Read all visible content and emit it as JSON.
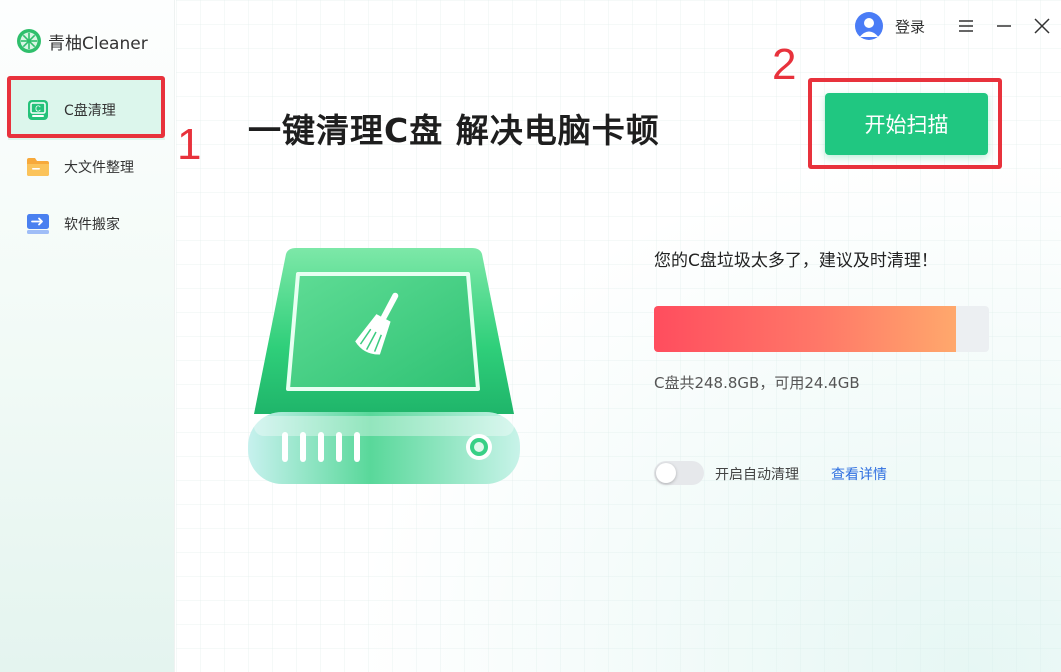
{
  "app": {
    "logo_text": "青柚Cleaner"
  },
  "sidebar": {
    "items": [
      {
        "label": "C盘清理",
        "icon": "disk-clean-icon",
        "active": true
      },
      {
        "label": "大文件整理",
        "icon": "folder-icon",
        "active": false
      },
      {
        "label": "软件搬家",
        "icon": "move-app-icon",
        "active": false
      }
    ]
  },
  "header": {
    "login_label": "登录"
  },
  "main": {
    "headline": "一键清理C盘 解决电脑卡顿",
    "scan_button": "开始扫描",
    "warning": "您的C盘垃圾太多了，建议及时清理！",
    "usage_fraction": 0.902,
    "disk_info": "C盘共248.8GB，可用24.4GB",
    "auto_clean_label": "开启自动清理",
    "auto_clean_on": false,
    "details_link": "查看详情"
  },
  "annotations": [
    {
      "number": "1"
    },
    {
      "number": "2"
    }
  ],
  "colors": {
    "accent": "#20c781",
    "warning_bar_start": "#ff4d5e",
    "warning_bar_end": "#ffa86c",
    "link": "#2f6fe0",
    "annotation": "#e8323c"
  }
}
